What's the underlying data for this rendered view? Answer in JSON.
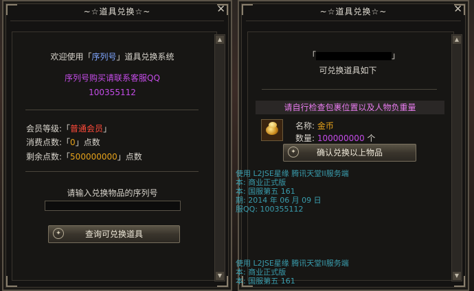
{
  "left_window": {
    "title": "~☆道具兑换☆~",
    "welcome_prefix": "欢迎使用「",
    "welcome_highlight": "序列号",
    "welcome_suffix": "」道具兑换系统",
    "purchase_note": "序列号购买请联系客服QQ",
    "qq": "100355112",
    "member_level_label": "会员等级:「",
    "member_level_value": "普通会员",
    "member_level_close": "」",
    "spent_label": "消费点数:「",
    "spent_value": "0",
    "spent_suffix": "」点数",
    "remaining_label": "剩余点数:「",
    "remaining_value": "500000000",
    "remaining_suffix": "」点数",
    "serial_prompt": "请输入兑换物品的序列号",
    "serial_input_value": "",
    "query_button": "查询可兑换道具"
  },
  "right_window": {
    "title": "~☆道具兑换☆~",
    "serial_open": "「",
    "serial_close": "」",
    "list_heading": "可兑换道具如下",
    "warning": "请自行检查包裹位置以及人物负重量",
    "item_name_label": "名称: ",
    "item_name_value": "金币",
    "item_qty_label": "数量: ",
    "item_qty_value": "100000000",
    "item_qty_unit": " 个",
    "confirm_button": "确认兑换以上物品",
    "item_icon": "gold-coins-icon"
  },
  "overlay_text_1": [
    "使用 L2JSE星缘 腾讯天堂II服务端",
    "本: 商业正式版",
    "本: 国服第五 161",
    "期: 2014 年 06 月 09 日",
    "服QQ: 100355112"
  ],
  "overlay_text_2": [
    "使用 L2JSE星缘 腾讯天堂II服务端",
    "本: 商业正式版",
    "本: 国服第五 161"
  ],
  "close_glyph": "✕",
  "scroll_up": "▲",
  "scroll_down": "▼",
  "button_icon_glyph": "✦"
}
